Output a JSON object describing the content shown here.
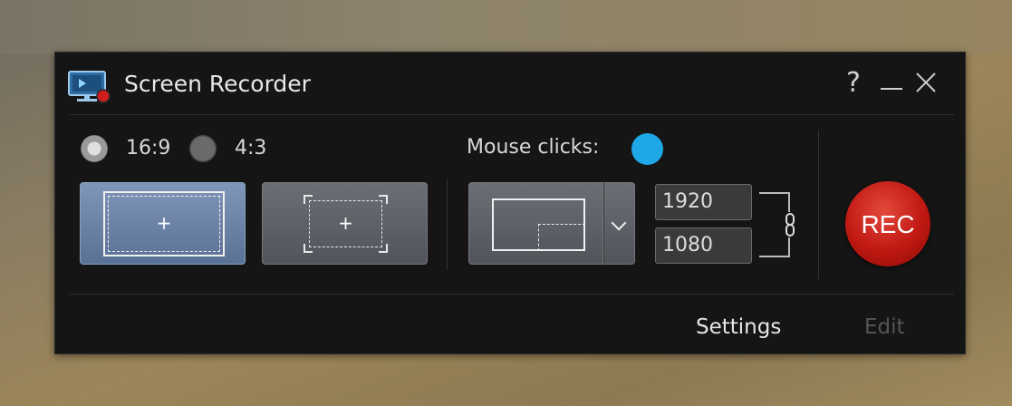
{
  "window": {
    "title": "Screen Recorder",
    "help_glyph": "?",
    "minimize_glyph": "—",
    "close_glyph": "✕"
  },
  "aspect": {
    "selected": "16:9",
    "options": [
      {
        "label": "16:9",
        "selected": true
      },
      {
        "label": "4:3",
        "selected": false
      }
    ]
  },
  "modes": {
    "fullscreen_plus": "+",
    "region_plus": "+",
    "active": "fullscreen"
  },
  "mouse_clicks": {
    "label": "Mouse clicks:",
    "color": "#1ea8e8"
  },
  "resolution": {
    "width": "1920",
    "height": "1080",
    "link_icon": "chain-link-icon",
    "link_glyph": "🔗"
  },
  "record": {
    "label": "REC",
    "color": "#c01812"
  },
  "footer": {
    "settings_label": "Settings",
    "edit_label": "Edit"
  },
  "icons": {
    "app": "screen-recorder-icon",
    "dropdown": "chevron-down-icon"
  }
}
